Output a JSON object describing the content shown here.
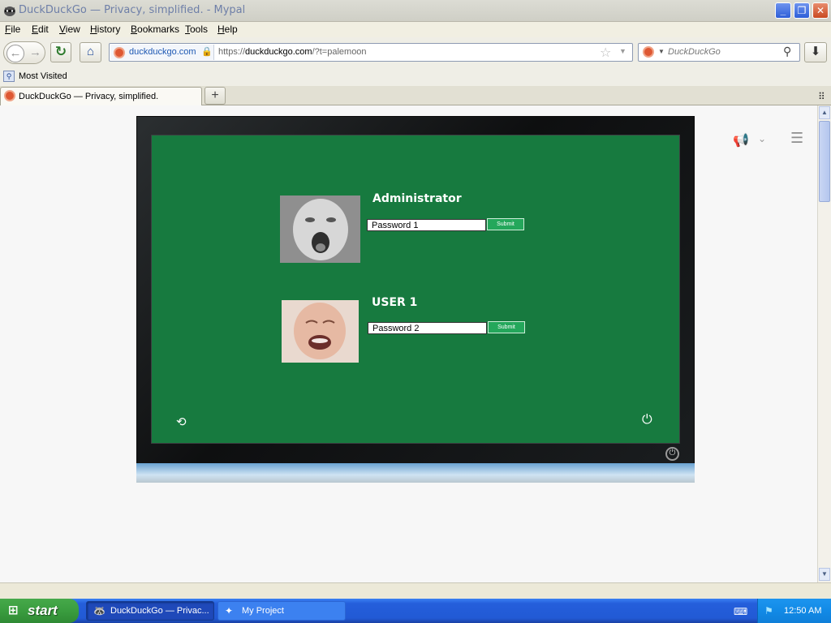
{
  "window": {
    "title": "DuckDuckGo — Privacy, simplified. - Mypal",
    "minimize": "_",
    "maximize": "❐",
    "close": "✕"
  },
  "menu": [
    "File",
    "Edit",
    "View",
    "History",
    "Bookmarks",
    "Tools",
    "Help"
  ],
  "toolbar": {
    "site_domain": "duckduckgo.com",
    "url_prefix": "https://",
    "url_host": "duckduckgo.com",
    "url_rest": "/?t=palemoon",
    "search_placeholder": "DuckDuckGo"
  },
  "bookmarks": {
    "most_visited": "Most Visited"
  },
  "tabs": [
    {
      "label": "DuckDuckGo — Privacy, simplified."
    }
  ],
  "login": {
    "users": [
      {
        "name": "Administrator",
        "password_value": "Password 1",
        "submit": "Submit"
      },
      {
        "name": "USER 1",
        "password_value": "Password 2",
        "submit": "Submit"
      }
    ]
  },
  "taskbar": {
    "start": "start",
    "tasks": [
      {
        "label": "DuckDuckGo — Privac..."
      },
      {
        "label": "My Project"
      }
    ],
    "clock": "12:50 AM"
  },
  "colors": {
    "screen_green": "#177a3f",
    "submit_green": "#24a75b",
    "ddg_orange": "#de5833"
  }
}
